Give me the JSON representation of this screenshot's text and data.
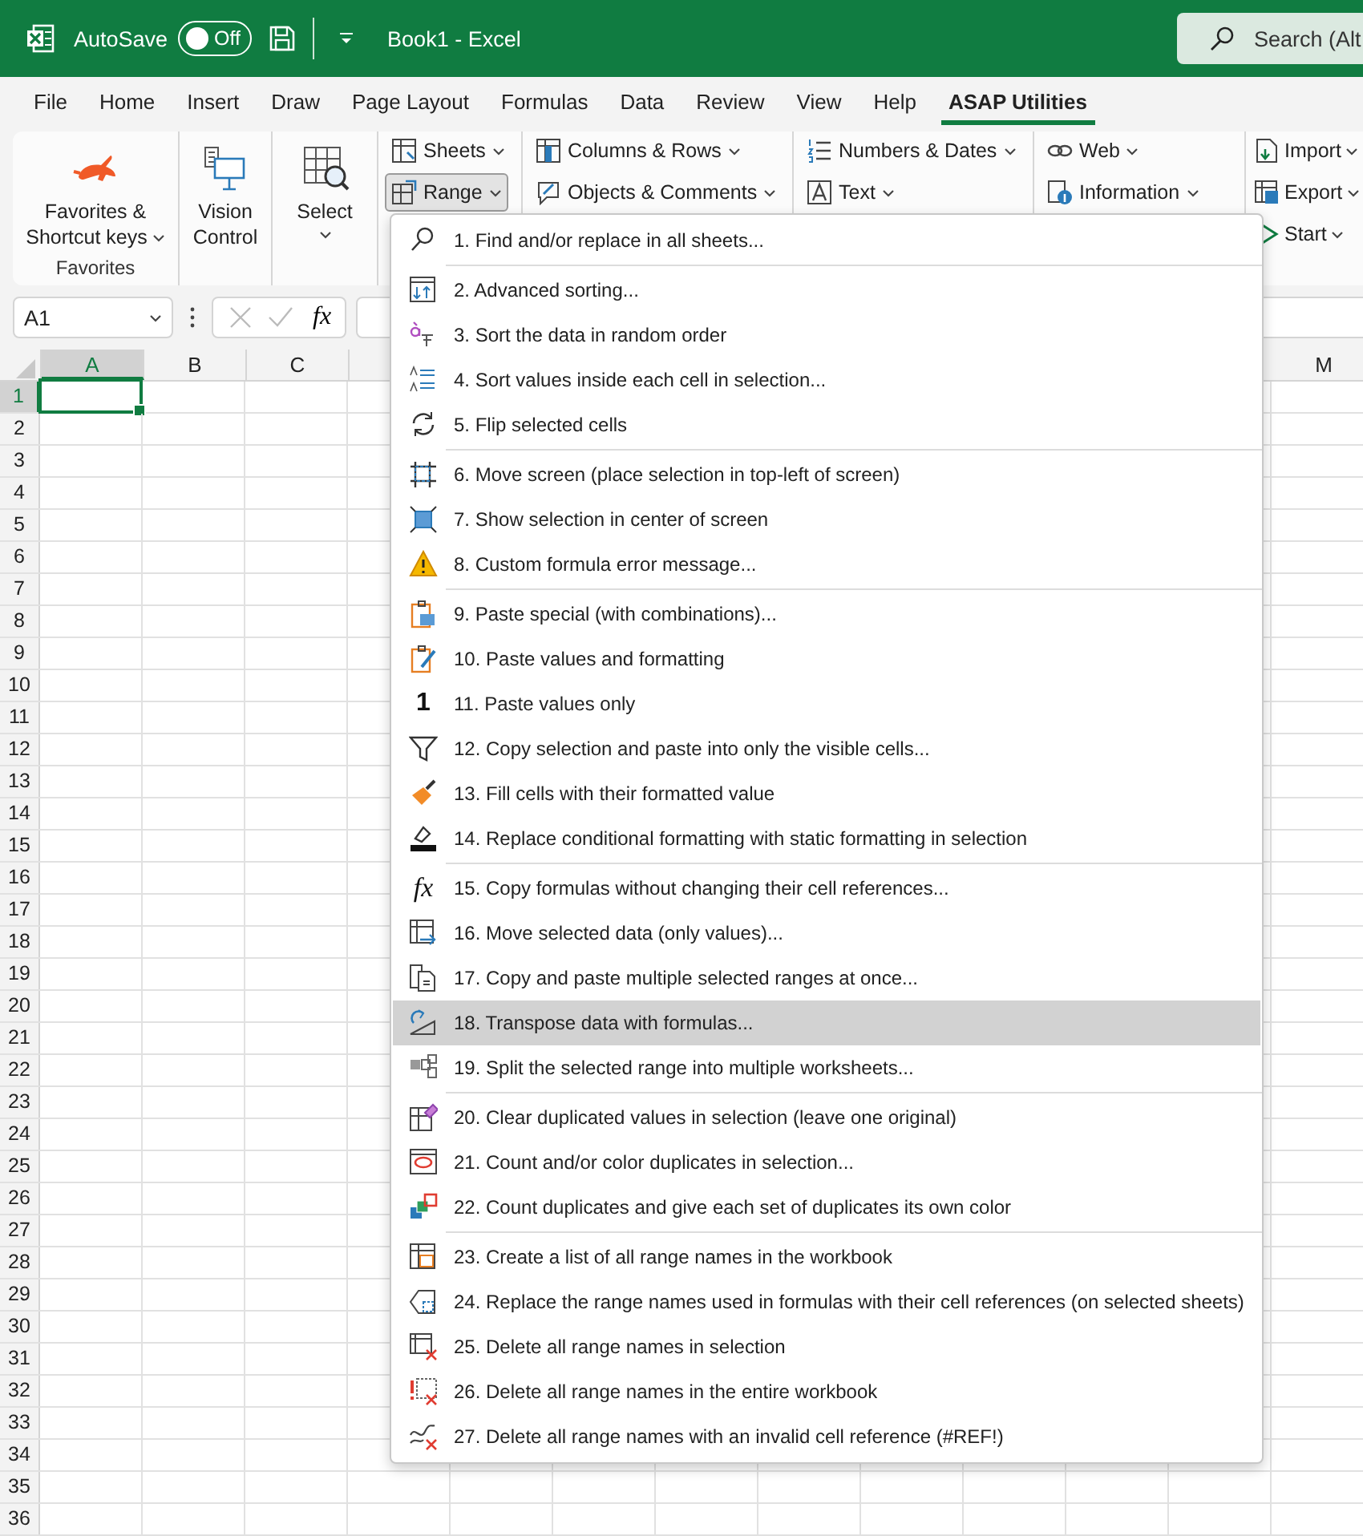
{
  "title_bar": {
    "autosave_label": "AutoSave",
    "autosave_toggle": {
      "label": "Off",
      "on": false
    },
    "document_title": "Book1  -  Excel",
    "search": {
      "placeholder": "Search (Alt"
    }
  },
  "ribbon_tabs": [
    {
      "label": "File",
      "selected": false
    },
    {
      "label": "Home",
      "selected": false
    },
    {
      "label": "Insert",
      "selected": false
    },
    {
      "label": "Draw",
      "selected": false
    },
    {
      "label": "Page Layout",
      "selected": false
    },
    {
      "label": "Formulas",
      "selected": false
    },
    {
      "label": "Data",
      "selected": false
    },
    {
      "label": "Review",
      "selected": false
    },
    {
      "label": "View",
      "selected": false
    },
    {
      "label": "Help",
      "selected": false
    },
    {
      "label": "ASAP Utilities",
      "selected": true
    }
  ],
  "ribbon": {
    "groups": [
      {
        "kind": "large",
        "label": "Favorites",
        "buttons": [
          {
            "lines": [
              "Favorites &",
              "Shortcut keys"
            ],
            "dropdown": true
          }
        ]
      },
      {
        "kind": "large",
        "buttons": [
          {
            "lines": [
              "Vision",
              "Control"
            ],
            "dropdown": false
          }
        ]
      },
      {
        "kind": "large",
        "buttons": [
          {
            "lines": [
              "Select"
            ],
            "dropdown": true
          }
        ]
      },
      {
        "kind": "small",
        "buttons": [
          {
            "label": "Sheets",
            "dropdown": true,
            "pressed": false
          },
          {
            "label": "Range",
            "dropdown": true,
            "pressed": true
          }
        ]
      },
      {
        "kind": "small",
        "buttons": [
          {
            "label": "Columns & Rows",
            "dropdown": true,
            "pressed": false
          },
          {
            "label": "Objects & Comments",
            "dropdown": true,
            "pressed": false
          }
        ]
      },
      {
        "kind": "small",
        "buttons": [
          {
            "label": "Numbers & Dates",
            "dropdown": true,
            "pressed": false
          },
          {
            "label": "Text",
            "dropdown": true,
            "pressed": false
          }
        ]
      },
      {
        "kind": "small",
        "buttons": [
          {
            "label": "Web",
            "dropdown": true,
            "pressed": false
          },
          {
            "label": "Information",
            "dropdown": true,
            "pressed": false
          }
        ]
      },
      {
        "kind": "small",
        "buttons": [
          {
            "label": "Import",
            "dropdown": true,
            "pressed": false
          },
          {
            "label": "Export",
            "dropdown": true,
            "pressed": false
          },
          {
            "label": "Start",
            "dropdown": true,
            "pressed": false
          }
        ]
      }
    ]
  },
  "formula_bar": {
    "name_box": "A1",
    "function_label": "fx"
  },
  "sheet": {
    "columns": [
      {
        "label": "A",
        "selected": true
      },
      {
        "label": "B",
        "selected": false
      },
      {
        "label": "C",
        "selected": false
      },
      {
        "label": "M",
        "selected": false
      }
    ],
    "rows": [
      {
        "label": "1",
        "selected": true
      },
      {
        "label": "2",
        "selected": false
      },
      {
        "label": "3",
        "selected": false
      },
      {
        "label": "4",
        "selected": false
      },
      {
        "label": "5",
        "selected": false
      },
      {
        "label": "6",
        "selected": false
      },
      {
        "label": "7",
        "selected": false
      },
      {
        "label": "8",
        "selected": false
      },
      {
        "label": "9",
        "selected": false
      },
      {
        "label": "10",
        "selected": false
      },
      {
        "label": "11",
        "selected": false
      },
      {
        "label": "12",
        "selected": false
      },
      {
        "label": "13",
        "selected": false
      },
      {
        "label": "14",
        "selected": false
      },
      {
        "label": "15",
        "selected": false
      },
      {
        "label": "16",
        "selected": false
      },
      {
        "label": "17",
        "selected": false
      },
      {
        "label": "18",
        "selected": false
      },
      {
        "label": "19",
        "selected": false
      },
      {
        "label": "20",
        "selected": false
      },
      {
        "label": "21",
        "selected": false
      },
      {
        "label": "22",
        "selected": false
      },
      {
        "label": "23",
        "selected": false
      },
      {
        "label": "24",
        "selected": false
      },
      {
        "label": "25",
        "selected": false
      },
      {
        "label": "26",
        "selected": false
      },
      {
        "label": "27",
        "selected": false
      },
      {
        "label": "28",
        "selected": false
      },
      {
        "label": "29",
        "selected": false
      },
      {
        "label": "30",
        "selected": false
      },
      {
        "label": "31",
        "selected": false
      },
      {
        "label": "32",
        "selected": false
      },
      {
        "label": "33",
        "selected": false
      },
      {
        "label": "34",
        "selected": false
      },
      {
        "label": "35",
        "selected": false
      },
      {
        "label": "36",
        "selected": false
      }
    ]
  },
  "range_menu": {
    "groups": [
      [
        {
          "label": "1. Find and/or replace in all sheets...",
          "selected": false
        }
      ],
      [
        {
          "label": "2. Advanced sorting...",
          "selected": false
        },
        {
          "label": "3. Sort the data in random order",
          "selected": false
        },
        {
          "label": "4. Sort values inside each cell in selection...",
          "selected": false
        },
        {
          "label": "5. Flip selected cells",
          "selected": false
        }
      ],
      [
        {
          "label": "6. Move screen (place selection in top-left of screen)",
          "selected": false
        },
        {
          "label": "7. Show selection in center of screen",
          "selected": false
        },
        {
          "label": "8. Custom formula error message...",
          "selected": false
        }
      ],
      [
        {
          "label": "9. Paste special (with combinations)...",
          "selected": false
        },
        {
          "label": "10. Paste values and formatting",
          "selected": false
        },
        {
          "label": "11. Paste values only",
          "selected": false,
          "glyph": "1"
        },
        {
          "label": "12. Copy selection and paste into only the visible cells...",
          "selected": false
        },
        {
          "label": "13. Fill cells with their formatted value",
          "selected": false
        },
        {
          "label": "14. Replace conditional formatting with static formatting in selection",
          "selected": false
        }
      ],
      [
        {
          "label": "15. Copy formulas without changing their cell references...",
          "selected": false,
          "glyph": "fx"
        },
        {
          "label": "16. Move selected data (only values)...",
          "selected": false
        },
        {
          "label": "17. Copy and paste multiple selected ranges at once...",
          "selected": false
        },
        {
          "label": "18. Transpose data with formulas...",
          "selected": true
        },
        {
          "label": "19. Split the selected range into multiple worksheets...",
          "selected": false
        }
      ],
      [
        {
          "label": "20. Clear duplicated values in selection (leave one original)",
          "selected": false
        },
        {
          "label": "21. Count and/or color duplicates in selection...",
          "selected": false
        },
        {
          "label": "22. Count duplicates and give each set of duplicates its own color",
          "selected": false
        }
      ],
      [
        {
          "label": "23. Create a list of all range names in the workbook",
          "selected": false
        },
        {
          "label": "24. Replace the range names used in formulas with their cell references (on selected sheets)",
          "selected": false
        },
        {
          "label": "25. Delete all range names in selection",
          "selected": false
        },
        {
          "label": "26. Delete all range names in the entire workbook",
          "selected": false
        },
        {
          "label": "27. Delete all range names with an invalid cell reference (#REF!)",
          "selected": false
        }
      ]
    ]
  }
}
